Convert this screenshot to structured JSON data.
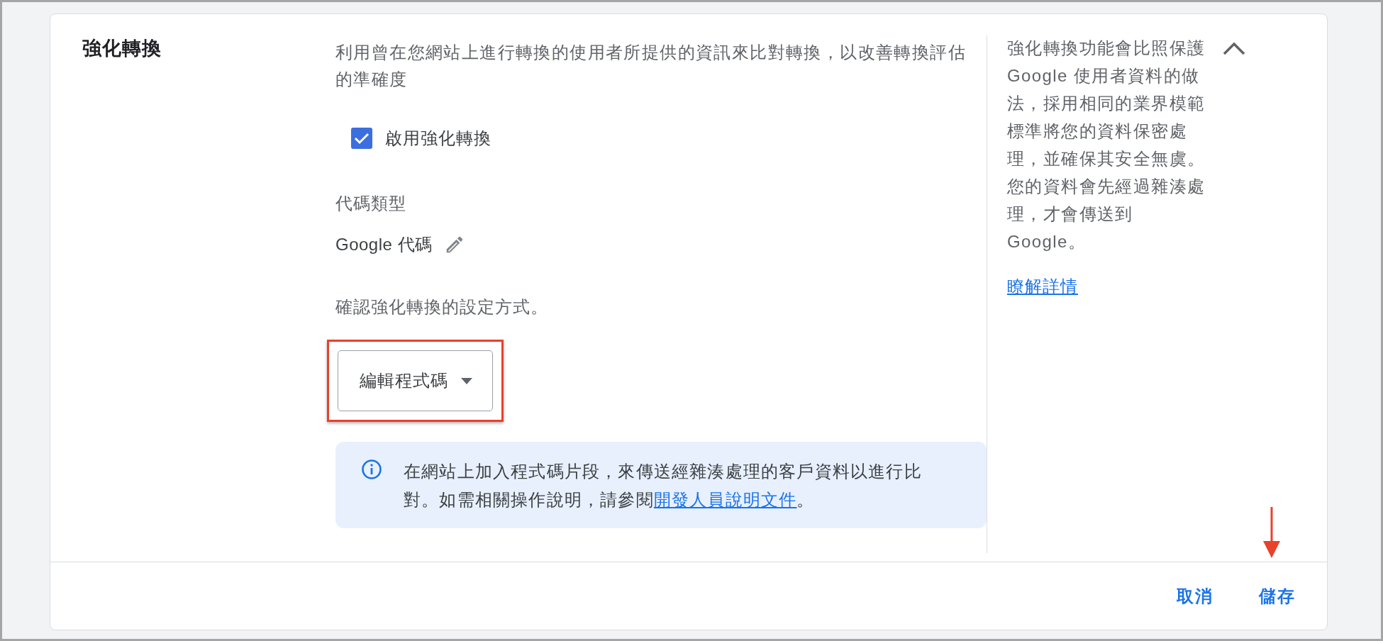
{
  "section": {
    "title": "強化轉換",
    "description": "利用曾在您網站上進行轉換的使用者所提供的資訊來比對轉換，以改善轉換評估的準確度",
    "expanded": true
  },
  "enable_checkbox": {
    "label": "啟用強化轉換",
    "checked": true
  },
  "tag_type": {
    "label": "代碼類型",
    "value": "Google 代碼"
  },
  "setup": {
    "prompt": "確認強化轉換的設定方式。",
    "dropdown": {
      "value": "編輯程式碼"
    }
  },
  "info": {
    "text": "在網站上加入程式碼片段，來傳送經雜湊處理的客戶資料以進行比對。如需相關操作說明，請參閱",
    "link": "開發人員說明文件",
    "suffix": "。"
  },
  "side_note": {
    "text": "強化轉換功能會比照保護 Google 使用者資料的做法，採用相同的業界模範標準將您的資料保密處理，並確保其安全無虞。您的資料會先經過雜湊處理，才會傳送到 Google。",
    "link": "瞭解詳情"
  },
  "buttons": [
    {
      "label": "取消"
    },
    {
      "label": "儲存"
    }
  ]
}
